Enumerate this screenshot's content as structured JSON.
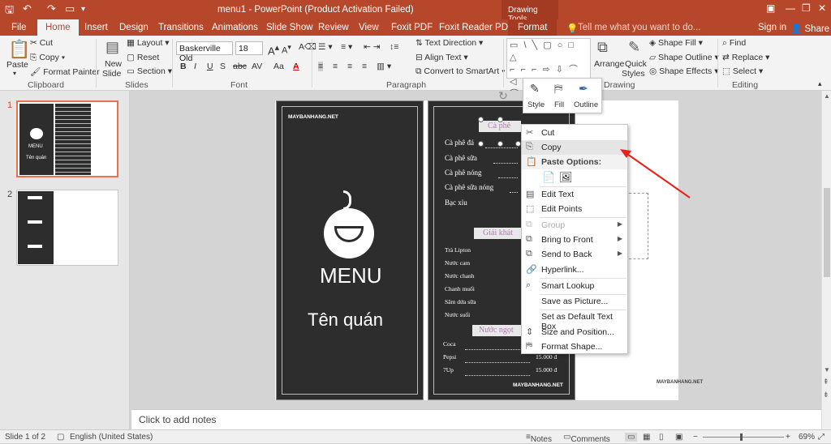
{
  "window": {
    "title": "menu1 - PowerPoint (Product Activation Failed)",
    "context_tab_group": "Drawing Tools",
    "signin": "Sign in",
    "share": "Share"
  },
  "tabs": [
    "File",
    "Home",
    "Insert",
    "Design",
    "Transitions",
    "Animations",
    "Slide Show",
    "Review",
    "View",
    "Foxit PDF",
    "Foxit Reader PDF",
    "Format"
  ],
  "tellme": "Tell me what you want to do...",
  "ribbon": {
    "clipboard": {
      "paste": "Paste",
      "cut": "Cut",
      "copy": "Copy",
      "format_painter": "Format Painter",
      "label": "Clipboard"
    },
    "slides": {
      "new_slide_1": "New",
      "new_slide_2": "Slide",
      "layout": "Layout",
      "reset": "Reset",
      "section": "Section",
      "label": "Slides"
    },
    "font": {
      "name": "Baskerville Old",
      "size": "18",
      "label": "Font",
      "bold": "B",
      "italic": "I",
      "underline": "U",
      "strike": "S",
      "shadow": "abc",
      "spacing": "AV",
      "case": "Aa",
      "color": "A"
    },
    "paragraph": {
      "text_direction": "Text Direction",
      "align_text": "Align Text",
      "convert_smartart": "Convert to SmartArt",
      "label": "Paragraph"
    },
    "drawing": {
      "arrange": "Arrange",
      "quick_styles_1": "Quick",
      "quick_styles_2": "Styles",
      "shape_fill": "Shape Fill",
      "shape_outline": "Shape Outline",
      "shape_effects": "Shape Effects",
      "label": "Drawing"
    },
    "editing": {
      "find": "Find",
      "replace": "Replace",
      "select": "Select",
      "label": "Editing"
    }
  },
  "mini_toolbar": {
    "style": "Style",
    "fill": "Fill",
    "outline": "Outline"
  },
  "slides_pane": [
    {
      "num": "1"
    },
    {
      "num": "2"
    }
  ],
  "thumb_menu": "MENU",
  "thumb_quan": "Tên quán",
  "slide": {
    "brand": "MAYBANHANG.NET",
    "menu_title": "MENU",
    "shop_name": "Tên quán",
    "sec1_title": "Cà phê",
    "sec1_items": [
      "Cà phê đá",
      "Cà phê sữa",
      "Cà phê nóng",
      "Cà phê sữa nóng",
      "Bạc xỉu"
    ],
    "sec2_title": "Giải khát",
    "sec2_items": [
      "Trà Lipton",
      "Nước cam",
      "Nước chanh",
      "Chanh muối",
      "Sâm dứa sữa",
      "Nước suối"
    ],
    "sec3_title": "Nước ngọt",
    "sec3_items": [
      {
        "name": "Coca",
        "price": ""
      },
      {
        "name": "Pepsi",
        "price": "15.000 đ"
      },
      {
        "name": "7Up",
        "price": "15.000 đ"
      }
    ],
    "right_brand": "MAYBANHANG.NET"
  },
  "context_menu": {
    "cut": "Cut",
    "copy": "Copy",
    "paste_options": "Paste Options:",
    "edit_text": "Edit Text",
    "edit_points": "Edit Points",
    "group": "Group",
    "bring_front": "Bring to Front",
    "send_back": "Send to Back",
    "hyperlink": "Hyperlink...",
    "smart_lookup": "Smart Lookup",
    "save_picture": "Save as Picture...",
    "set_default": "Set as Default Text Box",
    "size_position": "Size and Position...",
    "format_shape": "Format Shape..."
  },
  "notes_placeholder": "Click to add notes",
  "status": {
    "slide": "Slide 1 of 2",
    "language": "English (United States)",
    "notes": "Notes",
    "comments": "Comments",
    "zoom": "69%"
  },
  "colors": {
    "accent": "#b7472a",
    "arrow": "#e8221a"
  }
}
